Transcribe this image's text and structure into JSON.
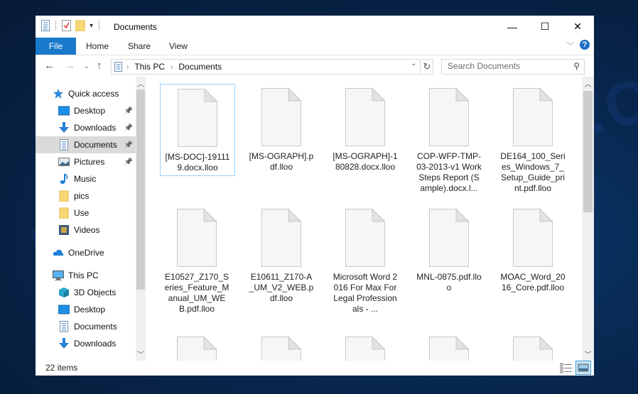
{
  "window": {
    "title": "Documents",
    "controls": {
      "minimize": "—",
      "maximize": "☐",
      "close": "✕"
    }
  },
  "ribbon": {
    "tabs": [
      {
        "label": "File"
      },
      {
        "label": "Home"
      },
      {
        "label": "Share"
      },
      {
        "label": "View"
      }
    ],
    "help": "?"
  },
  "nav": {
    "breadcrumb": [
      "This PC",
      "Documents"
    ],
    "search_placeholder": "Search Documents"
  },
  "sidebar": {
    "items": [
      {
        "label": "Quick access",
        "icon": "star-icon",
        "pinned": false
      },
      {
        "label": "Desktop",
        "icon": "desktop-icon",
        "pinned": true
      },
      {
        "label": "Downloads",
        "icon": "download-icon",
        "pinned": true
      },
      {
        "label": "Documents",
        "icon": "documents-icon",
        "pinned": true,
        "selected": true
      },
      {
        "label": "Pictures",
        "icon": "pictures-icon",
        "pinned": true
      },
      {
        "label": "Music",
        "icon": "music-icon",
        "pinned": false
      },
      {
        "label": "pics",
        "icon": "folder-icon",
        "pinned": false
      },
      {
        "label": "Use",
        "icon": "folder-icon",
        "pinned": false
      },
      {
        "label": "Videos",
        "icon": "videos-icon",
        "pinned": false
      },
      {
        "label": "OneDrive",
        "icon": "cloud-icon",
        "pinned": false
      },
      {
        "label": "This PC",
        "icon": "computer-icon",
        "pinned": false
      },
      {
        "label": "3D Objects",
        "icon": "cube-icon",
        "pinned": false
      },
      {
        "label": "Desktop",
        "icon": "desktop-icon",
        "pinned": false
      },
      {
        "label": "Documents",
        "icon": "documents-icon",
        "pinned": false
      },
      {
        "label": "Downloads",
        "icon": "download-icon",
        "pinned": false
      }
    ]
  },
  "files": [
    {
      "name": "[MS-DOC]-191119.docx.lloo",
      "selected": true
    },
    {
      "name": "[MS-OGRAPH].pdf.lloo"
    },
    {
      "name": "[MS-OGRAPH]-180828.docx.lloo"
    },
    {
      "name": "COP-WFP-TMP-03-2013-v1 Work Steps Report (Sample).docx.l..."
    },
    {
      "name": "DE164_100_Series_Windows_7_Setup_Guide_print.pdf.lloo"
    },
    {
      "name": "E10527_Z170_Series_Feature_Manual_UM_WEB.pdf.lloo"
    },
    {
      "name": "E10611_Z170-A_UM_V2_WEB.pdf.lloo"
    },
    {
      "name": "Microsoft Word 2016 For Max For Legal Professionals - ..."
    },
    {
      "name": "MNL-0875.pdf.lloo"
    },
    {
      "name": "MOAC_Word_2016_Core.pdf.lloo"
    },
    {
      "name": ""
    },
    {
      "name": ""
    },
    {
      "name": ""
    },
    {
      "name": ""
    },
    {
      "name": ""
    }
  ],
  "status": {
    "item_count": "22 items"
  },
  "watermark": "MYANTISPYWARE.COM"
}
